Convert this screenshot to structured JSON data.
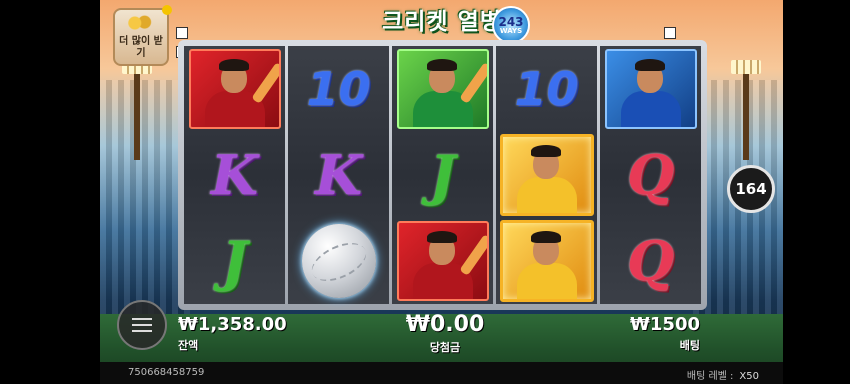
{
  "header": {
    "title": "크리켓 열병",
    "ways_number": "243",
    "ways_label": "WAYS"
  },
  "bonus_button": {
    "label": "더 많이 받기"
  },
  "reels": [
    [
      "portrait-red",
      "K",
      "J"
    ],
    [
      "10",
      "K",
      "cricket-ball"
    ],
    [
      "portrait-green",
      "J",
      "portrait-red"
    ],
    [
      "10",
      "portrait-gold",
      "portrait-gold"
    ],
    [
      "portrait-blue",
      "Q",
      "Q"
    ]
  ],
  "counter": {
    "value": "164"
  },
  "stats": {
    "balance": {
      "value": "₩1,358.00",
      "label": "잔액"
    },
    "win": {
      "value": "₩0.00",
      "label": "당첨금"
    },
    "bet": {
      "value": "₩1500",
      "label": "배팅"
    }
  },
  "footer": {
    "game_id": "750668458759",
    "bet_level_label": "배팅 레벨 :",
    "bet_level_value": "X50"
  },
  "colors": {
    "ten": "#3b6ff0",
    "k": "#a64fd8",
    "j": "#3fbf3a",
    "q": "#e83a56",
    "gold_frame": "#f6b325"
  }
}
